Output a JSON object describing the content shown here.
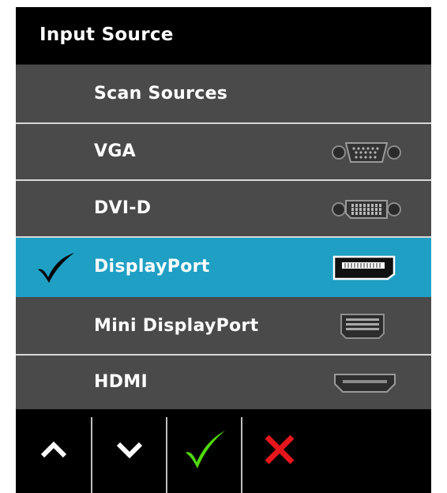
{
  "menu": {
    "title": "Input Source",
    "items": [
      {
        "label": "Scan Sources",
        "port": "none",
        "selected": false
      },
      {
        "label": "VGA",
        "port": "vga-port-icon",
        "selected": false
      },
      {
        "label": "DVI-D",
        "port": "dvi-port-icon",
        "selected": false
      },
      {
        "label": "DisplayPort",
        "port": "displayport-icon",
        "selected": true
      },
      {
        "label": "Mini DisplayPort",
        "port": "mini-displayport-icon",
        "selected": false
      },
      {
        "label": "HDMI",
        "port": "hdmi-port-icon",
        "selected": false
      }
    ]
  },
  "footer": {
    "buttons": [
      {
        "icon": "up-arrow-icon"
      },
      {
        "icon": "down-arrow-icon"
      },
      {
        "icon": "confirm-check-icon"
      },
      {
        "icon": "exit-x-icon"
      }
    ]
  },
  "colors": {
    "selected_bg": "#1f9fc4",
    "row_bg": "#4a4a4a",
    "header_bg": "#000000",
    "confirm_green": "#4fd80b",
    "exit_red": "#e8161b"
  }
}
